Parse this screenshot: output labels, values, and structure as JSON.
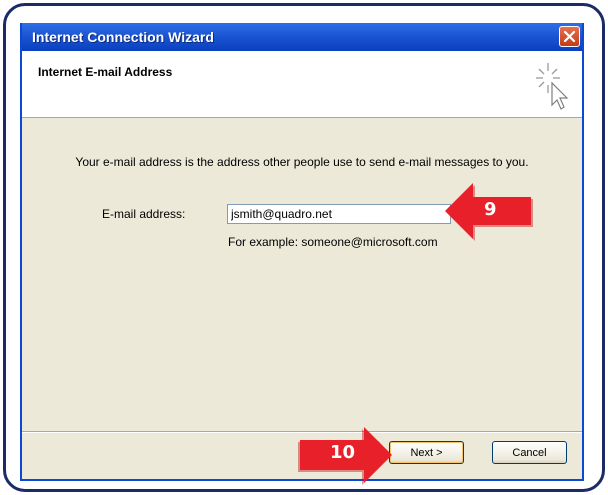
{
  "window": {
    "title": "Internet Connection Wizard"
  },
  "header": {
    "title": "Internet E-mail Address",
    "icon": "wizard-cursor-sparkle-icon"
  },
  "body": {
    "intro": "Your e-mail address is the address other people use to send e-mail messages to you.",
    "email_label": "E-mail address:",
    "email_value": "jsmith@quadro.net",
    "example": "For example: someone@microsoft.com"
  },
  "buttons": {
    "back_label": "",
    "next_label": "Next >",
    "cancel_label": "Cancel"
  },
  "annotations": {
    "step_9": "9",
    "step_10": "10",
    "arrow_color": "#e8202a"
  },
  "colors": {
    "titlebar": "#0a49d6",
    "frame": "#1c2a66",
    "dialog_bg": "#ece9d8",
    "close_button": "#d9532c"
  }
}
